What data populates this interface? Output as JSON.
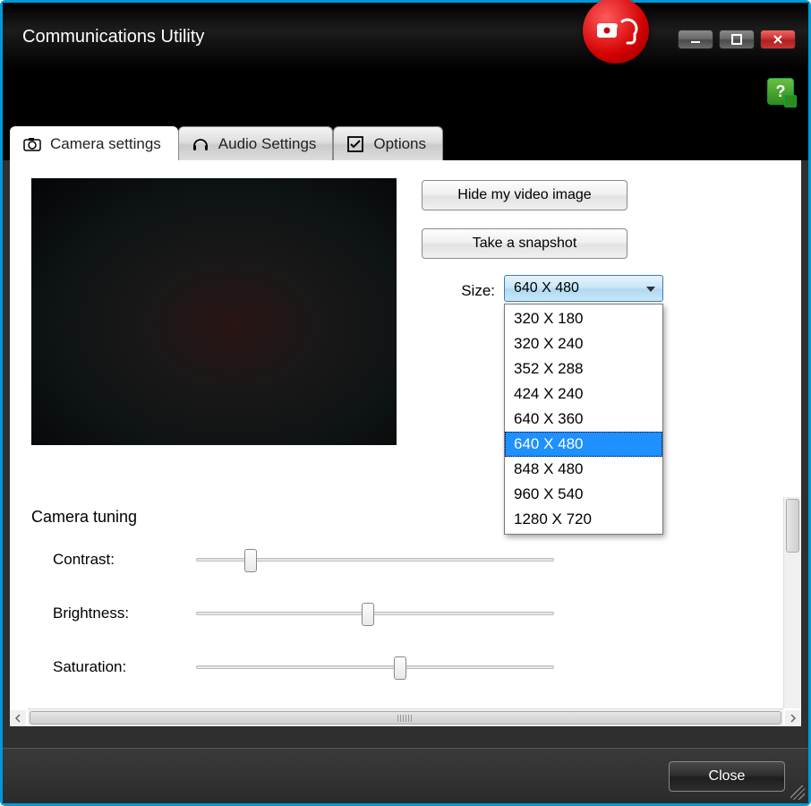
{
  "window": {
    "title": "Communications Utility"
  },
  "tabs": {
    "camera": "Camera settings",
    "audio": "Audio Settings",
    "options": "Options"
  },
  "actions": {
    "hide_video": "Hide my video image",
    "snapshot": "Take a snapshot"
  },
  "size": {
    "label": "Size:",
    "selected": "640 X 480",
    "options": [
      "320 X 180",
      "320 X 240",
      "352 X 288",
      "424 X 240",
      "640 X 360",
      "640 X 480",
      "848 X 480",
      "960 X 540",
      "1280 X 720"
    ]
  },
  "tuning": {
    "heading": "Camera tuning",
    "contrast_label": "Contrast:",
    "brightness_label": "Brightness:",
    "saturation_label": "Saturation:",
    "contrast_pct": 15,
    "brightness_pct": 48,
    "saturation_pct": 57
  },
  "footer": {
    "close": "Close"
  }
}
